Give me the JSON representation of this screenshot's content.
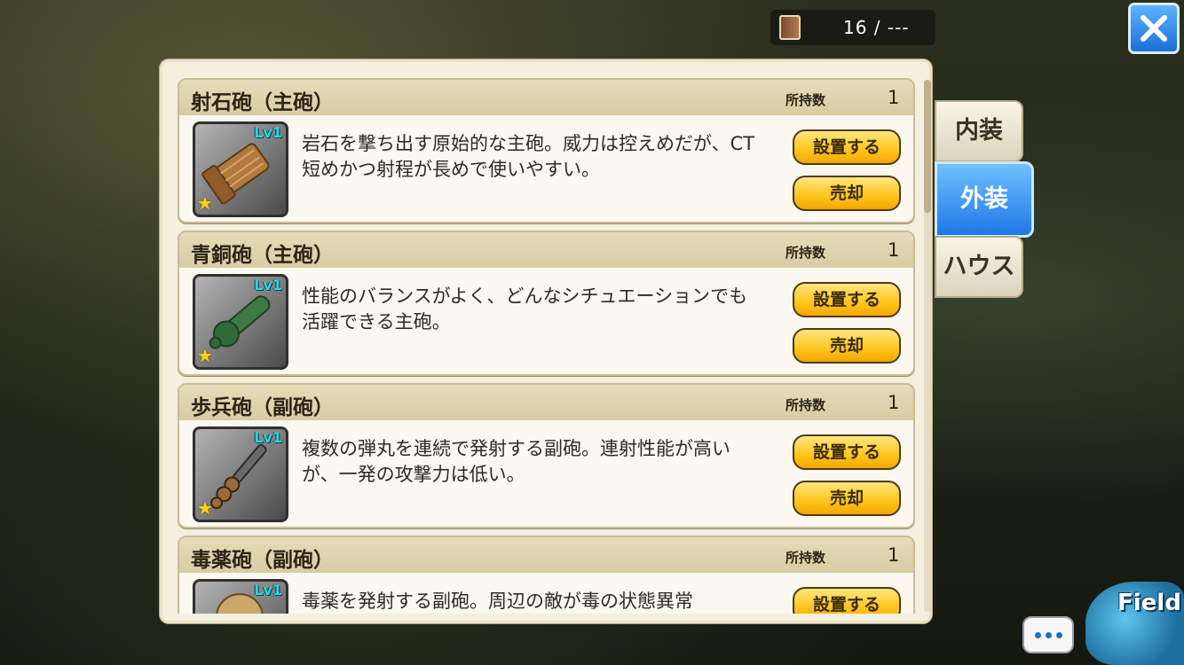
{
  "top_counter": {
    "text": "16 / ---",
    "icon": "book-icon"
  },
  "close_button": {
    "icon": "close-icon"
  },
  "tabs": [
    {
      "label": "内装",
      "active": false
    },
    {
      "label": "外装",
      "active": true
    },
    {
      "label": "ハウス",
      "active": false
    }
  ],
  "items": [
    {
      "name": "射石砲（主砲）",
      "held_label": "所持数",
      "held_count": "1",
      "level": "Lv1",
      "rarity_stars": 1,
      "description": "岩石を撃ち出す原始的な主砲。威力は控えめだが、CT短めかつ射程が長めで使いやすい。",
      "place_label": "設置する",
      "sell_label": "売却",
      "icon": "stone-cannon-icon"
    },
    {
      "name": "青銅砲（主砲）",
      "held_label": "所持数",
      "held_count": "1",
      "level": "Lv1",
      "rarity_stars": 1,
      "description": "性能のバランスがよく、どんなシチュエーションでも活躍できる主砲。",
      "place_label": "設置する",
      "sell_label": "売却",
      "icon": "bronze-cannon-icon"
    },
    {
      "name": "歩兵砲（副砲）",
      "held_label": "所持数",
      "held_count": "1",
      "level": "Lv1",
      "rarity_stars": 1,
      "description": "複数の弾丸を連続で発射する副砲。連射性能が高いが、一発の攻撃力は低い。",
      "place_label": "設置する",
      "sell_label": "売却",
      "icon": "infantry-gun-icon"
    },
    {
      "name": "毒薬砲（副砲）",
      "held_label": "所持数",
      "held_count": "1",
      "level": "Lv1",
      "rarity_stars": 1,
      "description": "毒薬を発射する副砲。周辺の敵が毒の状態異常",
      "place_label": "設置する",
      "sell_label": "売却",
      "icon": "poison-cannon-icon"
    }
  ],
  "bottom": {
    "field_label": "Field",
    "chat_icon": "chat-bubble-icon"
  }
}
